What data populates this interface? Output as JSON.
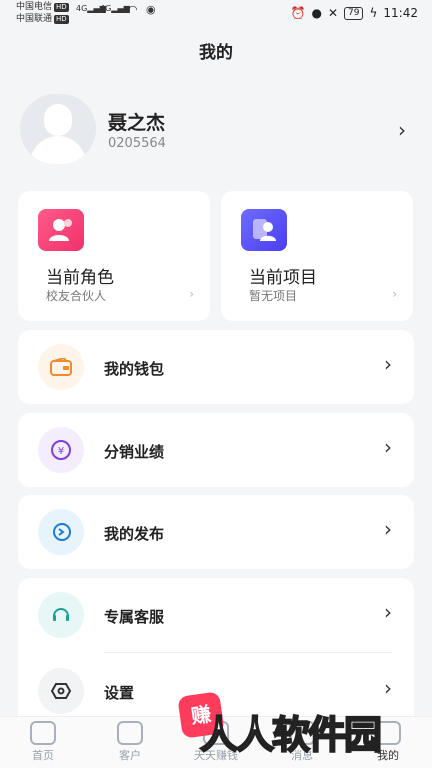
{
  "status_bar": {
    "carrier1": "中国电信",
    "carrier2": "中国联通",
    "hd": "HD",
    "net1": "4G",
    "net2": "4G",
    "battery": "79",
    "time": "11:42"
  },
  "header": {
    "title": "我的"
  },
  "profile": {
    "name": "聂之杰",
    "id": "0205564"
  },
  "cards": [
    {
      "title": "当前角色",
      "subtitle": "校友合伙人",
      "icon": "user-pair-icon",
      "color": "#f1316a"
    },
    {
      "title": "当前项目",
      "subtitle": "暂无项目",
      "icon": "project-user-icon",
      "color": "#4b3df2"
    }
  ],
  "menu": [
    {
      "label": "我的钱包",
      "icon": "wallet-icon",
      "color": "#f08a2b"
    },
    {
      "label": "分销业绩",
      "icon": "yen-coin-icon",
      "color": "#7b3fe4"
    },
    {
      "label": "我的发布",
      "icon": "publish-icon",
      "color": "#1a7bd8"
    },
    {
      "label": "专属客服",
      "icon": "headset-icon",
      "color": "#1a9f9a"
    },
    {
      "label": "设置",
      "icon": "settings-hex-icon",
      "color": "#333333"
    }
  ],
  "tabbar": {
    "items": [
      {
        "label": "首页",
        "icon": "home-icon"
      },
      {
        "label": "客户",
        "icon": "customer-icon"
      },
      {
        "label": "天天赚钱",
        "icon": "earn-icon"
      },
      {
        "label": "消息",
        "icon": "message-icon"
      },
      {
        "label": "我的",
        "icon": "profile-icon"
      }
    ]
  },
  "watermark": {
    "badge": "赚",
    "text": "人人软件园"
  }
}
